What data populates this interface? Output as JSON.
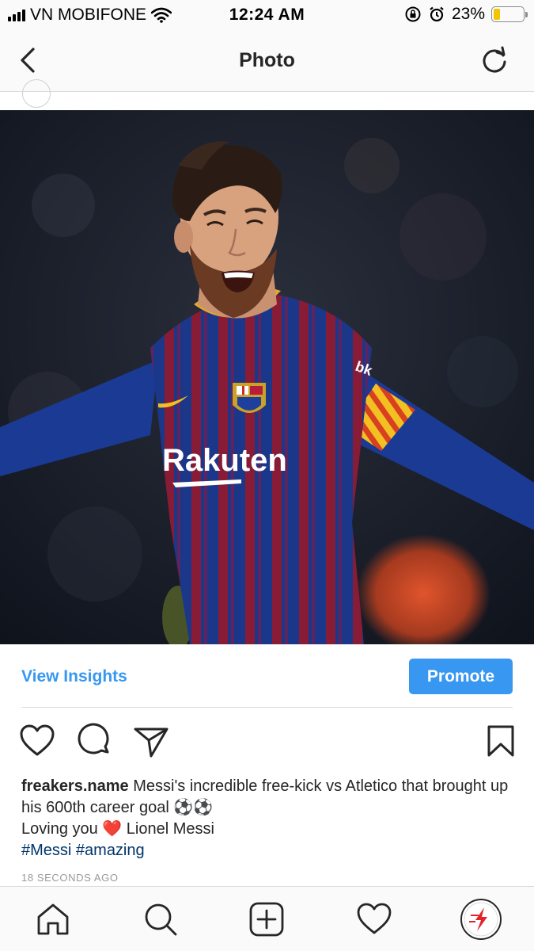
{
  "status_bar": {
    "carrier": "VN MOBIFONE",
    "time": "12:24 AM",
    "battery_percent": "23%",
    "battery_level": 0.23,
    "icons": [
      "signal-icon",
      "wifi-icon",
      "rotation-lock-icon",
      "alarm-icon",
      "battery-icon"
    ]
  },
  "header": {
    "title": "Photo",
    "back_icon": "chevron-left-icon",
    "refresh_icon": "refresh-icon"
  },
  "post": {
    "image_icon": "photo",
    "jersey_text": "Rakuten",
    "insights_label": "View Insights",
    "promote_label": "Promote",
    "actions": [
      "heart-icon",
      "comment-icon",
      "share-icon",
      "bookmark-icon"
    ],
    "caption": {
      "username": "freakers.name",
      "text": "Messi's incredible free-kick vs Atletico that brought up his 600th career goal ⚽⚽",
      "line2_prefix": "Loving you",
      "heart_emoji": "❤️",
      "line2_suffix": "Lionel Messi",
      "hashtags": "#Messi #amazing"
    },
    "timestamp": "18 SECONDS AGO"
  },
  "tab_bar": {
    "tabs": [
      "home-icon",
      "search-icon",
      "add-post-icon",
      "activity-icon",
      "profile-icon"
    ]
  },
  "colors": {
    "accent": "#3897f0",
    "hashtag": "#003569",
    "jersey_blue": "#1f3f9e",
    "jersey_red": "#9b1f3d"
  }
}
